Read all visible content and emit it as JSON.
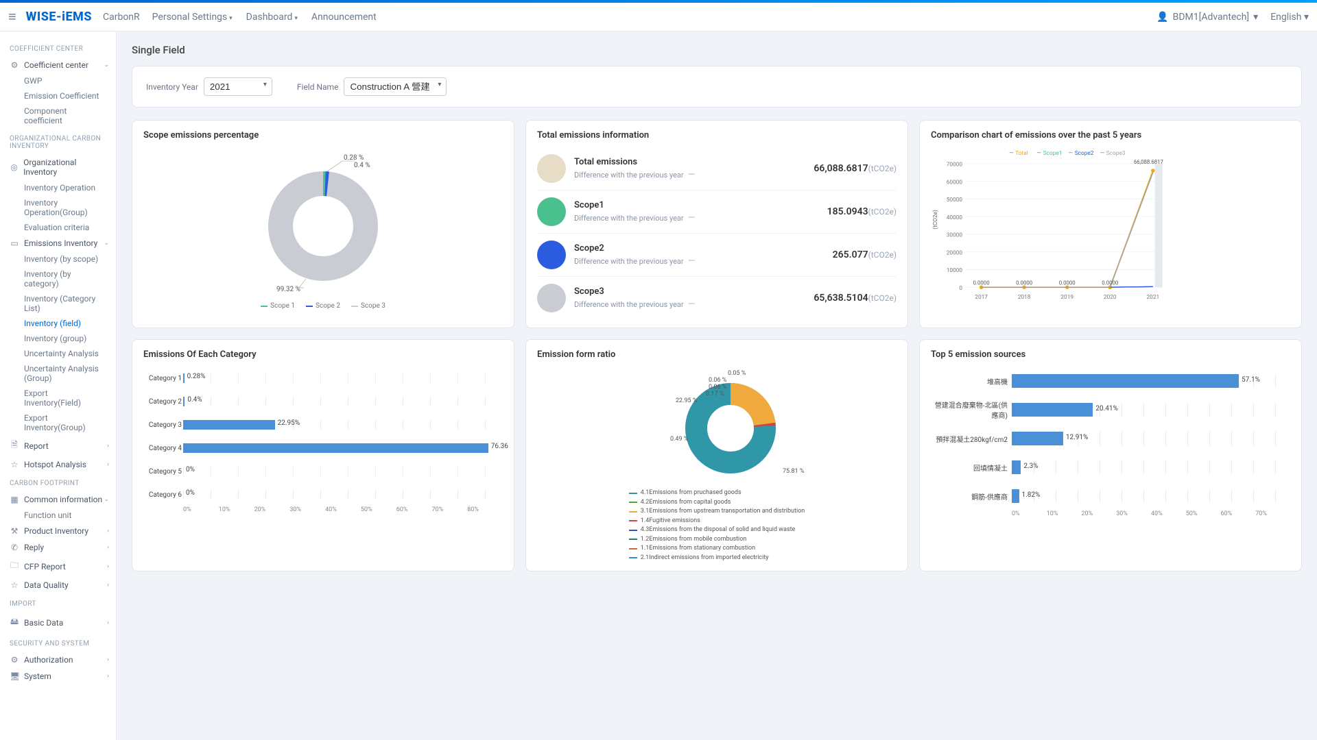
{
  "brand": "WISE-iEMS",
  "suite": "CarbonR",
  "nav": {
    "settings": "Personal Settings",
    "dashboard": "Dashboard",
    "announcement": "Announcement"
  },
  "user": "BDM1[Advantech]",
  "language": "English",
  "sidebar": {
    "h1": "COEFFICIENT CENTER",
    "coeff_center": "Coefficient center",
    "coeff_subs": [
      "GWP",
      "Emission Coefficient",
      "Component coefficient"
    ],
    "h2": "ORGANIZATIONAL CARBON INVENTORY",
    "org_inv": "Organizational Inventory",
    "org_subs": [
      "Inventory Operation",
      "Inventory Operation(Group)",
      "Evaluation criteria"
    ],
    "emis_inv": "Emissions Inventory",
    "emis_subs": [
      "Inventory (by scope)",
      "Inventory (by category)",
      "Inventory (Category List)",
      "Inventory (field)",
      "Inventory (group)",
      "Uncertainty Analysis",
      "Uncertainty Analysis (Group)",
      "Export Inventory(Field)",
      "Export Inventory(Group)"
    ],
    "report": "Report",
    "hotspot": "Hotspot Analysis",
    "h3": "CARBON FOOTPRINT",
    "common": "Common information",
    "common_subs": [
      "Function unit"
    ],
    "prod_inv": "Product Inventory",
    "reply": "Reply",
    "cfp": "CFP Report",
    "dq": "Data Quality",
    "h4": "IMPORT",
    "basic": "Basic Data",
    "h5": "SECURITY AND SYSTEM",
    "auth": "Authorization",
    "system": "System"
  },
  "page_title": "Single Field",
  "filters": {
    "year_label": "Inventory Year",
    "year_value": "2021",
    "field_label": "Field Name",
    "field_value": "Construction A 營建"
  },
  "cards": {
    "scope_pct": "Scope emissions percentage",
    "total_info": "Total emissions information",
    "comparison": "Comparison chart of emissions over the past 5 years",
    "by_cat": "Emissions Of Each Category",
    "form_ratio": "Emission form ratio",
    "top5": "Top 5 emission sources"
  },
  "unit": "(tCO2e)",
  "diff_label": "Difference with the previous year",
  "totals": [
    {
      "name": "Total emissions",
      "value": "66,088.6817",
      "color": "#e7dcc5"
    },
    {
      "name": "Scope1",
      "value": "185.0943",
      "color": "#4bc08f"
    },
    {
      "name": "Scope2",
      "value": "265.077",
      "color": "#2b5ce0"
    },
    {
      "name": "Scope3",
      "value": "65,638.5104",
      "color": "#c9cdd3"
    }
  ],
  "scope_legend": [
    "Scope 1",
    "Scope 2",
    "Scope 3"
  ],
  "chart_data": [
    {
      "type": "pie",
      "title": "Scope emissions percentage",
      "series": [
        {
          "name": "Scope 1",
          "value": 0.28,
          "color": "#4bc08f"
        },
        {
          "name": "Scope 2",
          "value": 0.4,
          "color": "#2b5ce0"
        },
        {
          "name": "Scope 3",
          "value": 99.32,
          "color": "#c9cdd3"
        }
      ]
    },
    {
      "type": "line",
      "title": "Comparison chart of emissions over the past 5 years",
      "ylabel": "(tCO2e)",
      "x": [
        "2017",
        "2018",
        "2019",
        "2020",
        "2021"
      ],
      "ylim": [
        0,
        70000
      ],
      "series": [
        {
          "name": "Total",
          "color": "#f2a618",
          "values": [
            0,
            0,
            0,
            0,
            66088.6817
          ]
        },
        {
          "name": "Scope1",
          "color": "#4bc08f",
          "values": [
            0,
            0,
            0,
            0,
            185.0943
          ]
        },
        {
          "name": "Scope2",
          "color": "#2b5ce0",
          "values": [
            0,
            0,
            0,
            0,
            265.077
          ]
        },
        {
          "name": "Scope3",
          "color": "#9aa3ad",
          "values": [
            0,
            0,
            0,
            0,
            65638.5104
          ]
        }
      ],
      "point_labels": [
        "0.0000",
        "0.0000",
        "0.0000",
        "0.0000",
        "66,088.6817"
      ]
    },
    {
      "type": "bar",
      "title": "Emissions Of Each Category",
      "orientation": "horizontal",
      "categories": [
        "Category 1",
        "Category 2",
        "Category 3",
        "Category 4",
        "Category 5",
        "Category 6"
      ],
      "values": [
        0.28,
        0.4,
        22.95,
        76.36,
        0,
        0
      ],
      "value_labels": [
        "0.28%",
        "0.4%",
        "22.95%",
        "76.36",
        "0%",
        "0%"
      ],
      "xlim": [
        0,
        80
      ]
    },
    {
      "type": "pie",
      "title": "Emission form ratio",
      "series": [
        {
          "name": "4.1Emissions from pruchased goods",
          "value": 75.81,
          "color": "#2f97a7"
        },
        {
          "name": "4.2Emissions from capital goods",
          "value": 0.49,
          "color": "#5aa33c"
        },
        {
          "name": "3.1Emissions from upstream transportation and  distribution",
          "value": 22.95,
          "color": "#f0a93c"
        },
        {
          "name": "1.4Fugitive  emissions",
          "value": 0.17,
          "color": "#d04545"
        },
        {
          "name": "4.3Emissions from the disposal of solid and liquid waste",
          "value": 0.06,
          "color": "#3352c4"
        },
        {
          "name": "1.2Emissions from mobile combustion",
          "value": 0.06,
          "color": "#1a8a62"
        },
        {
          "name": "1.1Emissions from stationary combustion",
          "value": 0.05,
          "color": "#c96c2a"
        },
        {
          "name": "2.1Indirect emissions from imported electricity",
          "value": 0.4,
          "color": "#3a8fbd"
        }
      ],
      "callouts": [
        "0.05 %",
        "0.06 %",
        "0.06 %",
        "0.17 %",
        "22.95 %",
        "0.49 %",
        "75.81 %"
      ]
    },
    {
      "type": "bar",
      "title": "Top 5 emission sources",
      "orientation": "horizontal",
      "categories": [
        "堆高機",
        "營建混合廢棄物-北區(供應商)",
        "預拌混凝土280kgf/cm2",
        "回填情凝土",
        "鋼筋-供應商"
      ],
      "values": [
        57.1,
        20.41,
        12.91,
        2.3,
        1.82
      ],
      "value_labels": [
        "57.1%",
        "20.41%",
        "12.91%",
        "2.3%",
        "1.82%"
      ],
      "xlim": [
        0,
        70
      ]
    }
  ]
}
